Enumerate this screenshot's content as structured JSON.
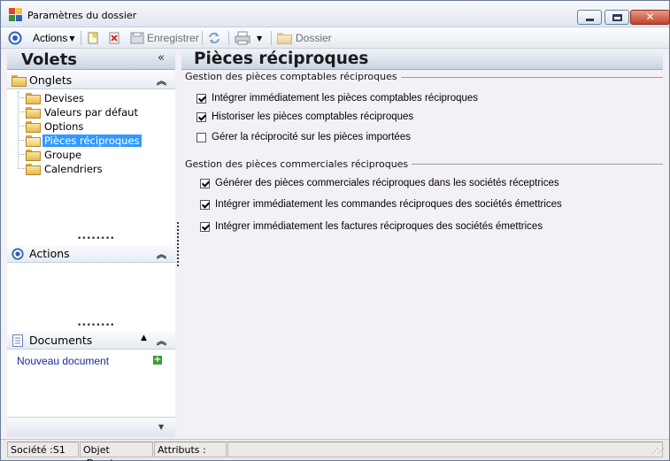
{
  "window": {
    "title": "Paramètres du dossier"
  },
  "toolbar": {
    "actions_label": "Actions",
    "save_label": "Enregistrer",
    "folder_label": "Dossier"
  },
  "left": {
    "title": "Volets",
    "onglets": {
      "label": "Onglets",
      "items": [
        "Devises",
        "Valeurs par défaut",
        "Options",
        "Pièces réciproques",
        "Groupe",
        "Calendriers"
      ],
      "selected": "Pièces réciproques"
    },
    "actions": {
      "label": "Actions"
    },
    "documents": {
      "label": "Documents",
      "new_link": "Nouveau document"
    }
  },
  "main": {
    "title": "Pièces réciproques",
    "groups": [
      {
        "title": "Gestion des pièces comptables réciproques",
        "options": [
          {
            "label": "Intégrer immédiatement les pièces comptables réciproques",
            "checked": true
          },
          {
            "label": "Historiser les pièces comptables réciproques",
            "checked": true
          },
          {
            "label": "Gérer la réciprocité sur les pièces importées",
            "checked": false
          }
        ]
      },
      {
        "title": "Gestion des pièces commerciales réciproques",
        "options": [
          {
            "label": "Générer des pièces commerciales réciproques dans les sociétés réceptrices",
            "checked": true
          },
          {
            "label": "Intégrer immédiatement les commandes réciproques des sociétés émettrices",
            "checked": true
          },
          {
            "label": "Intégrer immédiatement les factures réciproques des sociétés émettrices",
            "checked": true
          }
        ]
      }
    ]
  },
  "status": {
    "societe": "Société :S1",
    "objet": "Objet :Dossier",
    "attributs": "Attributs :"
  }
}
